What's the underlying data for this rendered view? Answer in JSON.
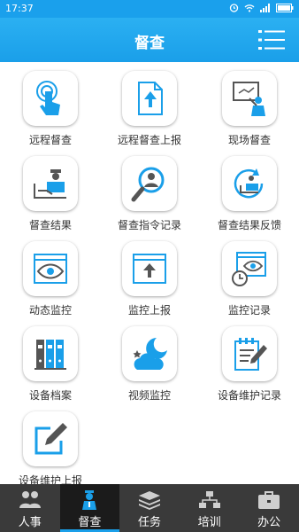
{
  "status": {
    "time": "17:37"
  },
  "header": {
    "title": "督查"
  },
  "items": [
    {
      "label": "远程督查",
      "icon": "touch-icon"
    },
    {
      "label": "远程督查上报",
      "icon": "upload-doc-icon"
    },
    {
      "label": "现场督查",
      "icon": "presentation-icon"
    },
    {
      "label": "督查结果",
      "icon": "inspector-desk-icon"
    },
    {
      "label": "督查指令记录",
      "icon": "magnifier-person-icon"
    },
    {
      "label": "督查结果反馈",
      "icon": "feedback-cycle-icon"
    },
    {
      "label": "动态监控",
      "icon": "eye-window-icon"
    },
    {
      "label": "监控上报",
      "icon": "upload-window-icon"
    },
    {
      "label": "监控记录",
      "icon": "eye-clock-icon"
    },
    {
      "label": "设备档案",
      "icon": "binders-icon"
    },
    {
      "label": "视频监控",
      "icon": "night-cloud-icon"
    },
    {
      "label": "设备维护记录",
      "icon": "notepad-pen-icon"
    },
    {
      "label": "设备维护上报",
      "icon": "edit-icon"
    }
  ],
  "tabs": [
    {
      "label": "人事",
      "icon": "people-icon",
      "active": false
    },
    {
      "label": "督查",
      "icon": "inspector-icon",
      "active": true
    },
    {
      "label": "任务",
      "icon": "stack-icon",
      "active": false
    },
    {
      "label": "培训",
      "icon": "network-icon",
      "active": false
    },
    {
      "label": "办公",
      "icon": "briefcase-icon",
      "active": false
    }
  ],
  "colors": {
    "accent": "#1a9fe9",
    "tabbar": "#3a3a3a"
  }
}
